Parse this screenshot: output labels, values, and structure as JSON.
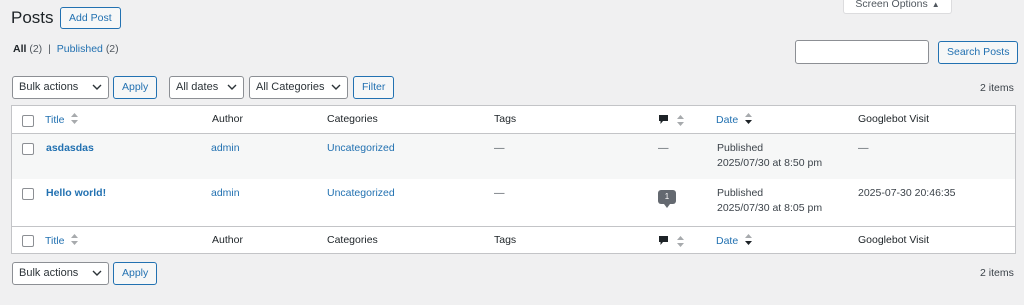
{
  "header": {
    "title": "Posts",
    "add_new_label": "Add Post",
    "screen_options_label": "Screen Options"
  },
  "views": {
    "all_label": "All",
    "all_count": "(2)",
    "separator": "|",
    "published_label": "Published",
    "published_count": "(2)"
  },
  "search": {
    "value": "",
    "button_label": "Search Posts"
  },
  "tablenav_top": {
    "bulk_actions": "Bulk actions",
    "apply_label": "Apply",
    "dates_filter": "All dates",
    "categories_filter": "All Categories",
    "filter_label": "Filter",
    "items_count": "2 items"
  },
  "tablenav_bottom": {
    "bulk_actions": "Bulk actions",
    "apply_label": "Apply",
    "items_count": "2 items"
  },
  "columns": {
    "title": "Title",
    "author": "Author",
    "categories": "Categories",
    "tags": "Tags",
    "date": "Date",
    "googlebot": "Googlebot Visit"
  },
  "rows": [
    {
      "title": "asdasdas",
      "author": "admin",
      "categories": "Uncategorized",
      "tags": "—",
      "comments": "—",
      "status": "Published",
      "date": "2025/07/30 at 8:50 pm",
      "googlebot": "—"
    },
    {
      "title": "Hello world!",
      "author": "admin",
      "categories": "Uncategorized",
      "tags": "—",
      "comments": "1",
      "status": "Published",
      "date": "2025/07/30 at 8:05 pm",
      "googlebot": "2025-07-30 20:46:35"
    }
  ],
  "colors": {
    "accent": "#2271b1",
    "background": "#f0f0f1",
    "border": "#c3c4c7"
  }
}
